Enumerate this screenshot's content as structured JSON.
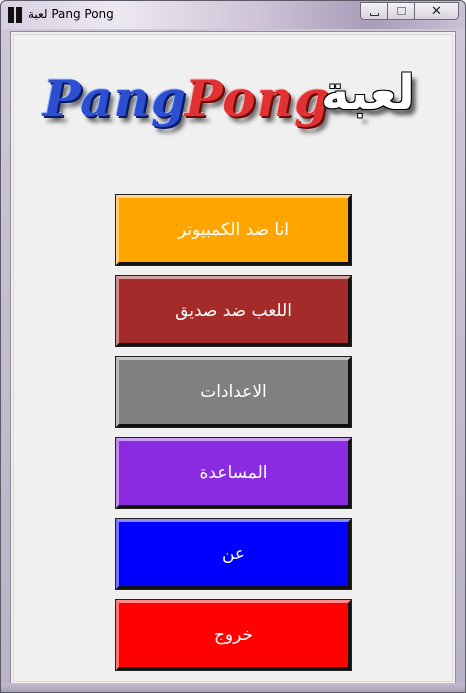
{
  "window": {
    "title": "لعبة Pang Pong",
    "controls": {
      "minimize": "minimize",
      "maximize": "maximize",
      "close": "✕"
    }
  },
  "logo": {
    "word_1": "Pang",
    "word_2": "Pong",
    "word_3": "لعبة",
    "colors": {
      "pang": "#2b4fcf",
      "pong": "#e03232",
      "arabic": "#ffffff"
    }
  },
  "menu": {
    "buttons": [
      {
        "label": "انا ضد الكمبيوتر",
        "color": "#ffa500"
      },
      {
        "label": "اللعب ضد صديق",
        "color": "#a52a2a"
      },
      {
        "label": "الاعدادات",
        "color": "#808080"
      },
      {
        "label": "المساعدة",
        "color": "#8a2be2"
      },
      {
        "label": "عن",
        "color": "#0000ff"
      },
      {
        "label": "خروج",
        "color": "#ff0000"
      }
    ]
  }
}
